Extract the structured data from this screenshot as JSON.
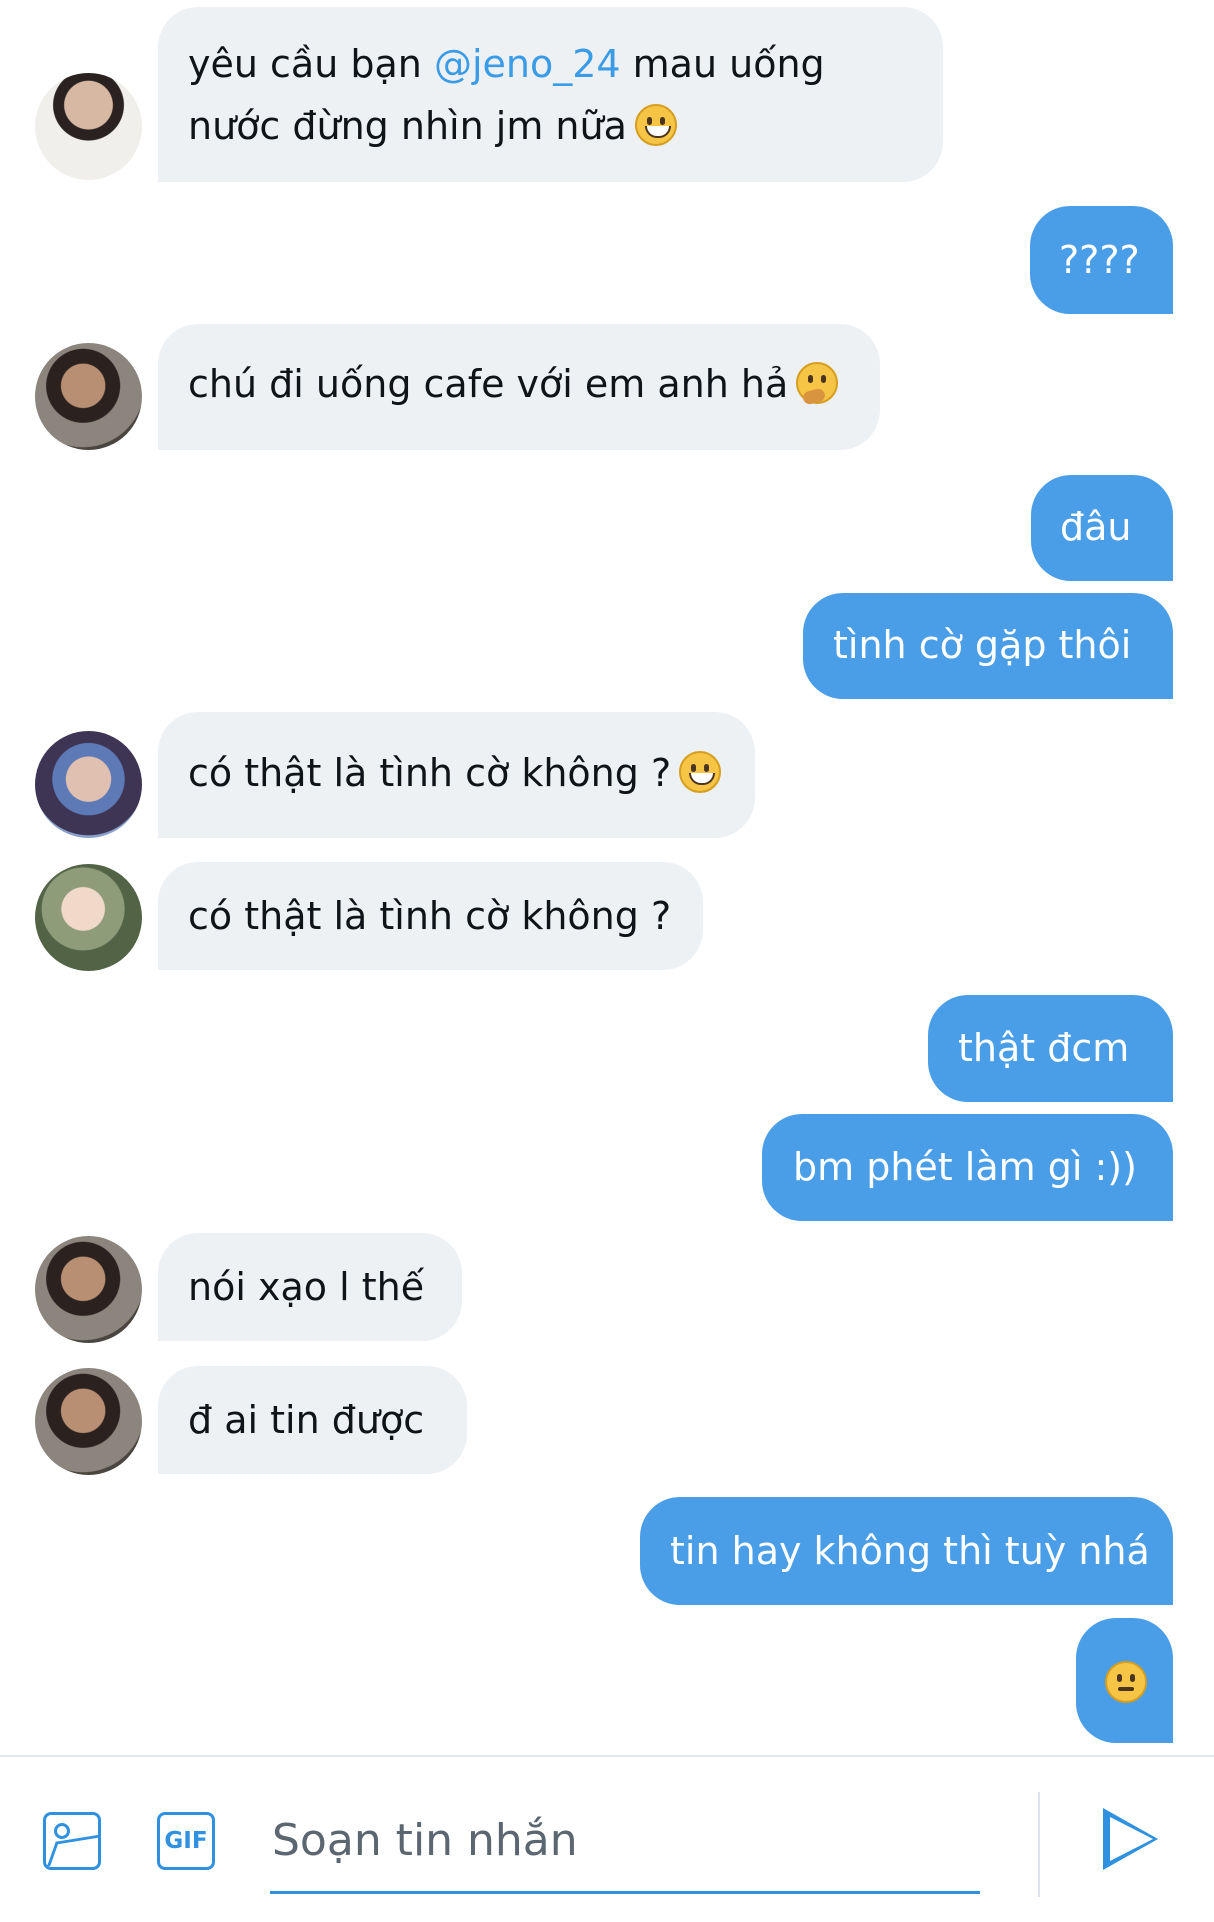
{
  "messages": [
    {
      "line1_prefix": "yêu cầu bạn ",
      "mention": "@jeno_24",
      "line1_suffix": " mau uống",
      "line2": "nước đừng nhìn jm nữa"
    },
    {
      "text": "????"
    },
    {
      "text": "chú đi uống cafe với em anh hả"
    },
    {
      "text": "đâu"
    },
    {
      "text": "tình cờ gặp thôi"
    },
    {
      "text": "có thật là tình cờ không ?"
    },
    {
      "text": "có thật là tình cờ không ?"
    },
    {
      "text": "thật đcm"
    },
    {
      "text": "bm phét làm gì  :))"
    },
    {
      "text": "nói xạo l thế"
    },
    {
      "text": "đ ai tin được"
    },
    {
      "text": "tin hay không thì tuỳ nhá"
    }
  ],
  "composer": {
    "placeholder": "Soạn tin nhắn",
    "gif_label": "GIF"
  },
  "colors": {
    "accent": "#1d9bf0",
    "outgoing_bubble": "#4a9ee8",
    "incoming_bubble": "#eef1f4"
  },
  "icons": {
    "photo": "photo-icon",
    "gif": "gif-icon",
    "send": "send-icon",
    "emojis": [
      "grinning-face-emoji",
      "thinking-face-emoji",
      "unamused-face-emoji"
    ]
  }
}
